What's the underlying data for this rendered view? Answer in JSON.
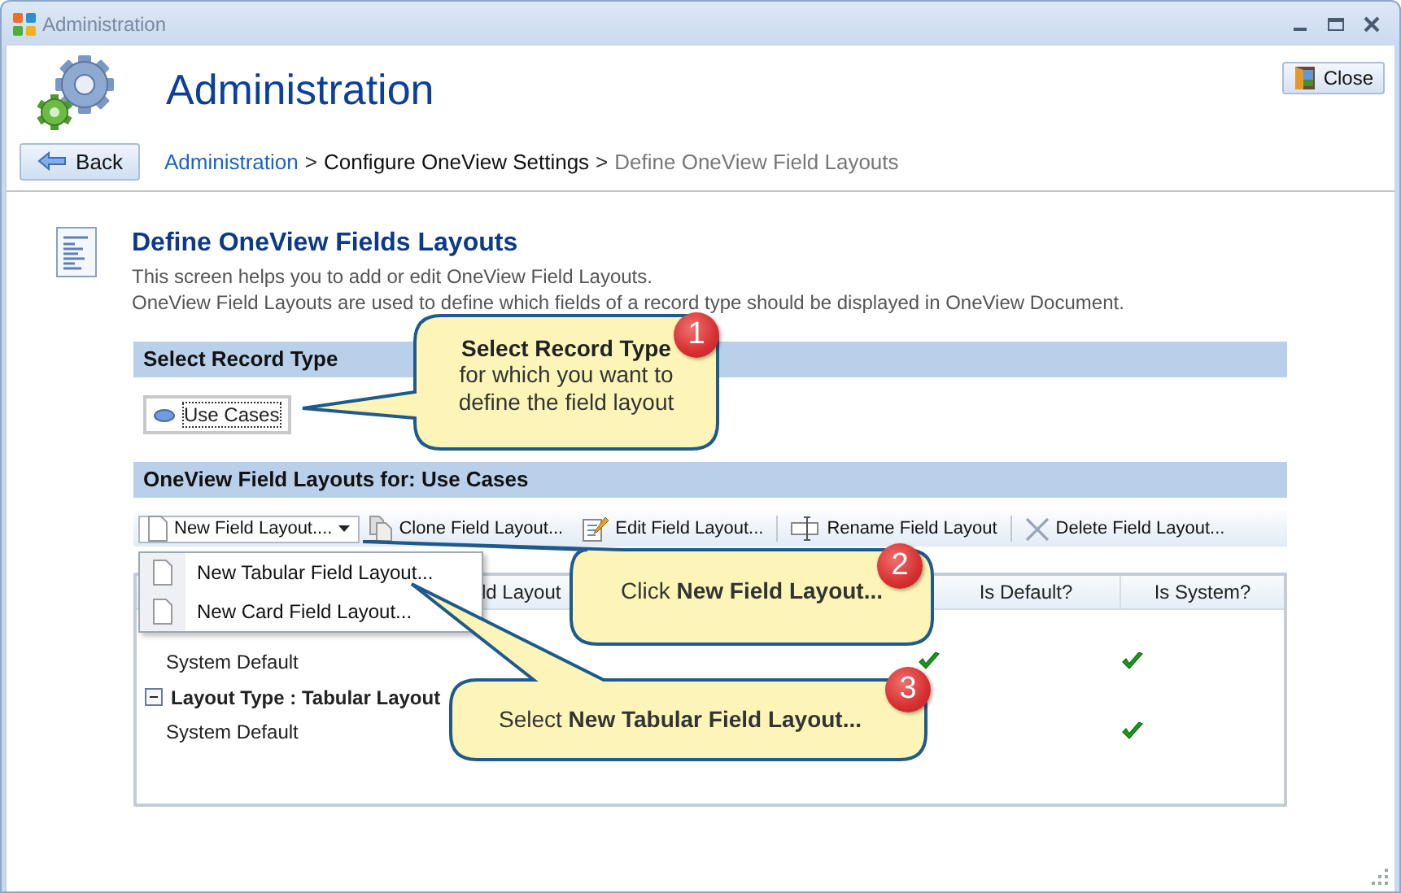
{
  "window": {
    "title": "Administration"
  },
  "header": {
    "title": "Administration",
    "close_button": "Close",
    "back_button": "Back"
  },
  "breadcrumb": {
    "separator": ">",
    "items": [
      {
        "label": "Administration",
        "kind": "link"
      },
      {
        "label": "Configure OneView Settings",
        "kind": "parent"
      },
      {
        "label": "Define OneView Field Layouts",
        "kind": "current"
      }
    ]
  },
  "page": {
    "heading": "Define OneView Fields Layouts",
    "description": [
      "This screen helps you to add or edit OneView Field Layouts.",
      "OneView Field Layouts are used to define which fields of a record type should be displayed in OneView Document."
    ]
  },
  "record_type_section": {
    "title": "Select Record Type",
    "options": [
      {
        "label": "Use Cases",
        "selected": true
      }
    ]
  },
  "layouts_section": {
    "title": "OneView Field Layouts for: Use Cases",
    "toolbar": [
      {
        "label": "New Field Layout....",
        "kind": "new"
      },
      {
        "label": "Clone Field Layout...",
        "kind": "clone"
      },
      {
        "label": "Edit Field Layout...",
        "kind": "edit"
      },
      {
        "label": "Rename Field Layout",
        "kind": "rename"
      },
      {
        "label": "Delete Field Layout...",
        "kind": "delete"
      }
    ],
    "menu": [
      {
        "label": "New Tabular Field Layout..."
      },
      {
        "label": "New Card Field Layout..."
      }
    ],
    "columns": [
      "ld Layout",
      "Is Default?",
      "Is System?"
    ],
    "groups": [
      {
        "rows": [
          {
            "name": "System Default",
            "is_default": true,
            "is_system": true
          }
        ]
      },
      {
        "title": "Layout Type : Tabular Layout",
        "expanded": true,
        "rows": [
          {
            "name": "System Default",
            "is_default": false,
            "is_system": true
          }
        ]
      }
    ]
  },
  "callouts": [
    {
      "number": "1",
      "title": "Select Record Type",
      "text": "for which you want to define the field layout"
    },
    {
      "number": "2",
      "text": "Click **New Field Layout...**"
    },
    {
      "number": "3",
      "text": "Select **New Tabular Field Layout...**"
    }
  ]
}
